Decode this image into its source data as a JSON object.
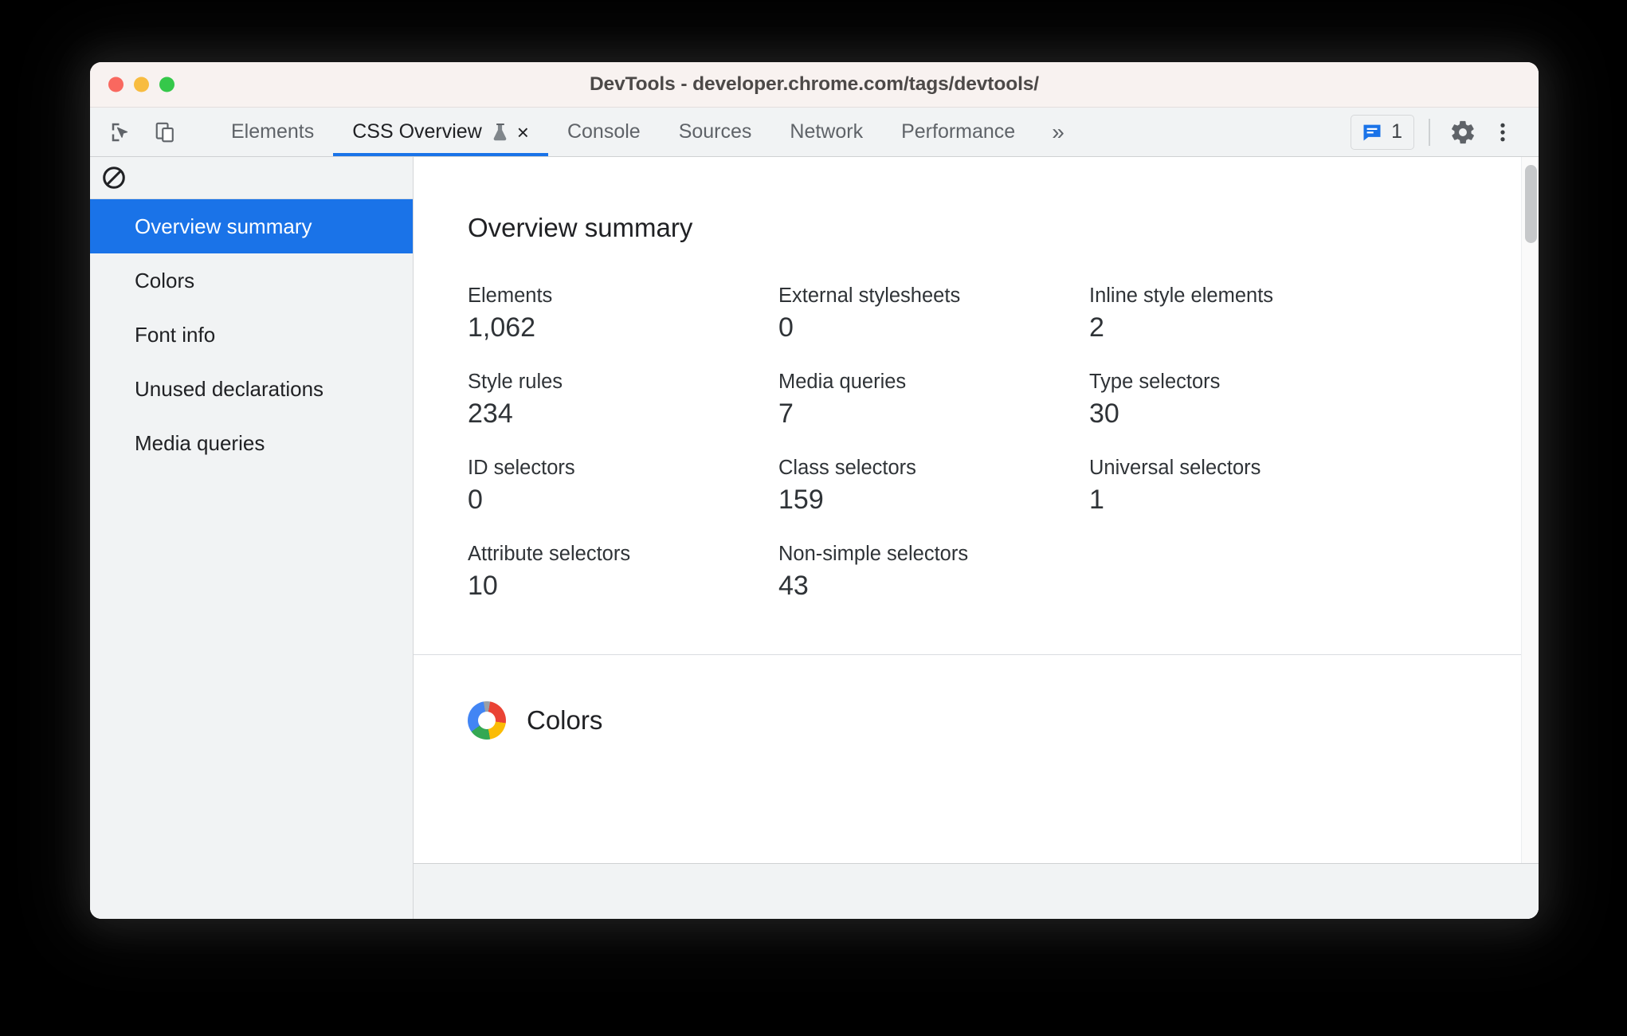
{
  "window": {
    "title": "DevTools - developer.chrome.com/tags/devtools/",
    "traffic_lights": [
      "close",
      "minimize",
      "maximize"
    ]
  },
  "tabstrip": {
    "inspect_icon": "inspect-cursor-icon",
    "device_icon": "device-toolbar-icon",
    "tabs": [
      {
        "label": "Elements",
        "active": false,
        "closable": false,
        "experiment": false
      },
      {
        "label": "CSS Overview",
        "active": true,
        "closable": true,
        "experiment": true,
        "close_label": "×"
      },
      {
        "label": "Console",
        "active": false,
        "closable": false,
        "experiment": false
      },
      {
        "label": "Sources",
        "active": false,
        "closable": false,
        "experiment": false
      },
      {
        "label": "Network",
        "active": false,
        "closable": false,
        "experiment": false
      },
      {
        "label": "Performance",
        "active": false,
        "closable": false,
        "experiment": false
      }
    ],
    "more_tabs_label": "»",
    "issues_count": "1",
    "settings_icon": "gear-icon",
    "menu_icon": "more-vertical-icon",
    "accent_color": "#1a73e8"
  },
  "sidebar": {
    "clear_icon": "no-entry-clear-icon",
    "items": [
      {
        "label": "Overview summary",
        "selected": true
      },
      {
        "label": "Colors",
        "selected": false
      },
      {
        "label": "Font info",
        "selected": false
      },
      {
        "label": "Unused declarations",
        "selected": false
      },
      {
        "label": "Media queries",
        "selected": false
      }
    ]
  },
  "main": {
    "summary_title": "Overview summary",
    "stats": [
      {
        "label": "Elements",
        "value": "1,062"
      },
      {
        "label": "External stylesheets",
        "value": "0"
      },
      {
        "label": "Inline style elements",
        "value": "2"
      },
      {
        "label": "Style rules",
        "value": "234"
      },
      {
        "label": "Media queries",
        "value": "7"
      },
      {
        "label": "Type selectors",
        "value": "30"
      },
      {
        "label": "ID selectors",
        "value": "0"
      },
      {
        "label": "Class selectors",
        "value": "159"
      },
      {
        "label": "Universal selectors",
        "value": "1"
      },
      {
        "label": "Attribute selectors",
        "value": "10"
      },
      {
        "label": "Non-simple selectors",
        "value": "43"
      }
    ],
    "colors_section": {
      "title": "Colors",
      "icon": "color-wheel-icon"
    }
  }
}
